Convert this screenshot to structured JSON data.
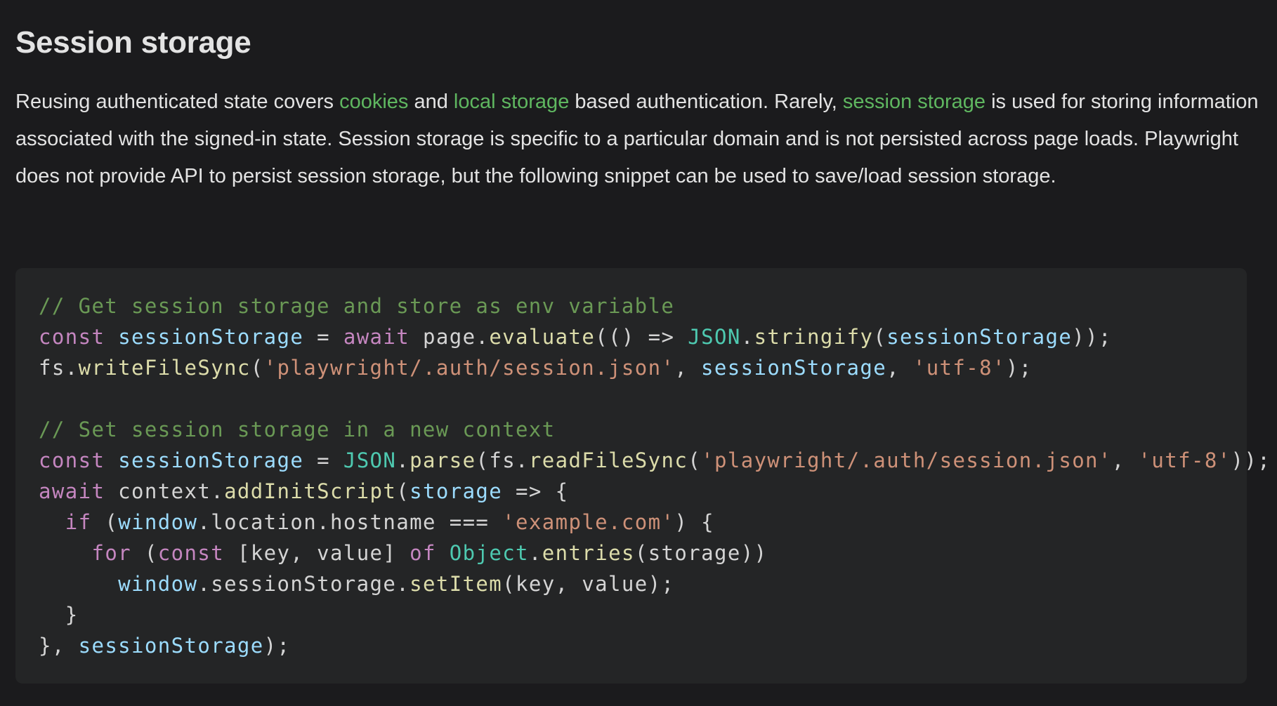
{
  "heading": "Session storage",
  "intro": {
    "t1": "Reusing authenticated state covers ",
    "link_cookies": "cookies",
    "t2": " and ",
    "link_local_storage": "local storage",
    "t3": " based authentication. Rarely, ",
    "link_session_storage": "session storage",
    "t4": " is used for storing information associated with the signed-in state. Session storage is specific to a particular domain and is not persisted across page loads. Playwright does not provide API to persist session storage, but the following snippet can be used to save/load session storage."
  },
  "code": {
    "lines": [
      [
        [
          "comment",
          "// Get session storage and store as env variable"
        ]
      ],
      [
        [
          "kw",
          "const"
        ],
        [
          "plain",
          " "
        ],
        [
          "var",
          "sessionStorage"
        ],
        [
          "plain",
          " = "
        ],
        [
          "kw",
          "await"
        ],
        [
          "plain",
          " page."
        ],
        [
          "fn",
          "evaluate"
        ],
        [
          "plain",
          "(() => "
        ],
        [
          "class",
          "JSON"
        ],
        [
          "plain",
          "."
        ],
        [
          "fn",
          "stringify"
        ],
        [
          "plain",
          "("
        ],
        [
          "var",
          "sessionStorage"
        ],
        [
          "plain",
          "));"
        ]
      ],
      [
        [
          "plain",
          "fs."
        ],
        [
          "fn",
          "writeFileSync"
        ],
        [
          "plain",
          "("
        ],
        [
          "str",
          "'playwright/.auth/session.json'"
        ],
        [
          "plain",
          ", "
        ],
        [
          "var",
          "sessionStorage"
        ],
        [
          "plain",
          ", "
        ],
        [
          "str",
          "'utf-8'"
        ],
        [
          "plain",
          ");"
        ]
      ],
      [],
      [
        [
          "comment",
          "// Set session storage in a new context"
        ]
      ],
      [
        [
          "kw",
          "const"
        ],
        [
          "plain",
          " "
        ],
        [
          "var",
          "sessionStorage"
        ],
        [
          "plain",
          " = "
        ],
        [
          "class",
          "JSON"
        ],
        [
          "plain",
          "."
        ],
        [
          "fn",
          "parse"
        ],
        [
          "plain",
          "(fs."
        ],
        [
          "fn",
          "readFileSync"
        ],
        [
          "plain",
          "("
        ],
        [
          "str",
          "'playwright/.auth/session.json'"
        ],
        [
          "plain",
          ", "
        ],
        [
          "str",
          "'utf-8'"
        ],
        [
          "plain",
          "));"
        ]
      ],
      [
        [
          "kw",
          "await"
        ],
        [
          "plain",
          " context."
        ],
        [
          "fn",
          "addInitScript"
        ],
        [
          "plain",
          "("
        ],
        [
          "var",
          "storage"
        ],
        [
          "plain",
          " => {"
        ]
      ],
      [
        [
          "plain",
          "  "
        ],
        [
          "kw",
          "if"
        ],
        [
          "plain",
          " ("
        ],
        [
          "var",
          "window"
        ],
        [
          "plain",
          ".location.hostname === "
        ],
        [
          "str",
          "'example.com'"
        ],
        [
          "plain",
          ") {"
        ]
      ],
      [
        [
          "plain",
          "    "
        ],
        [
          "kw",
          "for"
        ],
        [
          "plain",
          " ("
        ],
        [
          "kw",
          "const"
        ],
        [
          "plain",
          " [key, value] "
        ],
        [
          "kw",
          "of"
        ],
        [
          "plain",
          " "
        ],
        [
          "class",
          "Object"
        ],
        [
          "plain",
          "."
        ],
        [
          "fn",
          "entries"
        ],
        [
          "plain",
          "(storage))"
        ]
      ],
      [
        [
          "plain",
          "      "
        ],
        [
          "var",
          "window"
        ],
        [
          "plain",
          ".sessionStorage."
        ],
        [
          "fn",
          "setItem"
        ],
        [
          "plain",
          "(key, value);"
        ]
      ],
      [
        [
          "plain",
          "  }"
        ]
      ],
      [
        [
          "plain",
          "}, "
        ],
        [
          "var",
          "sessionStorage"
        ],
        [
          "plain",
          ");"
        ]
      ]
    ]
  }
}
